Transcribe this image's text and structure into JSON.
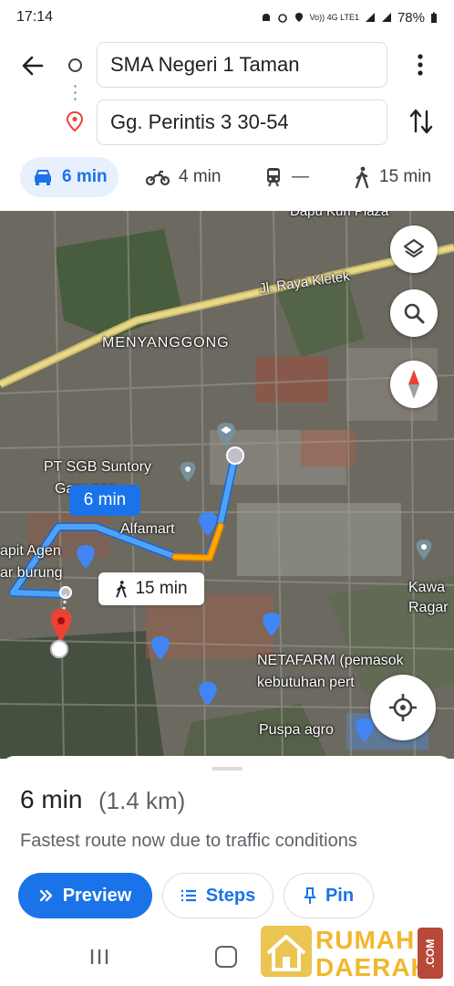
{
  "status_bar": {
    "time": "17:14",
    "network": "Vo)) 4G LTE1",
    "battery": "78%"
  },
  "directions": {
    "origin": "SMA Negeri 1 Taman",
    "destination": "Gg. Perintis 3 30-54"
  },
  "modes": {
    "drive": "6 min",
    "motorcycle": "4 min",
    "transit": "—",
    "walk": "15 min"
  },
  "map": {
    "labels": {
      "top_plaza": "Dapu Kuri Plaza",
      "road": "Jl. Raya Kletek",
      "area": "MENYANGGONG",
      "pt_sgb_1": "PT SGB Suntory",
      "pt_sgb_2": "Garu      age",
      "alfamart": "Alfamart",
      "agen_1": "apit Agen",
      "agen_2": "ar burung",
      "kawasan_1": "Kawa",
      "kawasan_2": "Ragar",
      "netafarm_1": "NETAFARM (pemasok",
      "netafarm_2": "kebutuhan pert",
      "puspa": "Puspa agro"
    },
    "route_chip": "6 min",
    "walk_chip": "15 min",
    "route_color": "#4285f4",
    "traffic_color": "#f29900",
    "destination_color": "#ea4335"
  },
  "summary": {
    "time": "6 min",
    "distance": "(1.4 km)",
    "description": "Fastest route now due to traffic conditions"
  },
  "actions": {
    "preview": "Preview",
    "steps": "Steps",
    "pin": "Pin"
  },
  "watermark": {
    "line1": "RUMAH",
    "line2": "DAERAH",
    "suffix": ".COM"
  }
}
